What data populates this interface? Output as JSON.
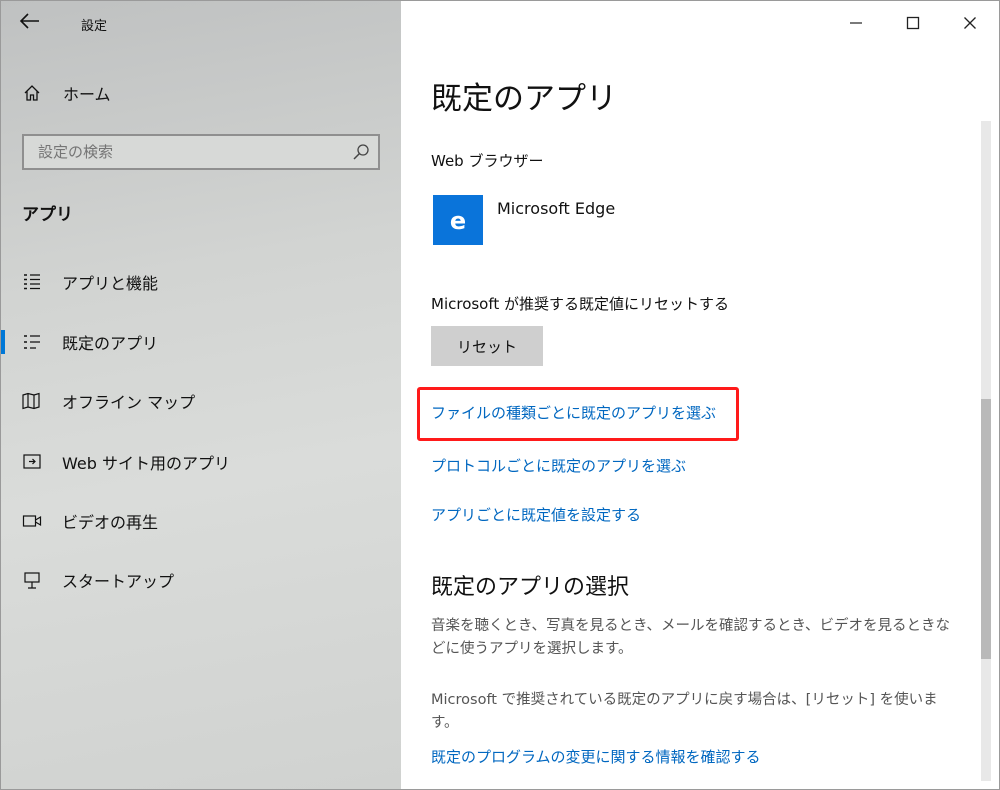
{
  "window": {
    "title": "設定",
    "minimize_icon": "minimize-icon",
    "maximize_icon": "maximize-icon",
    "close_icon": "close-icon"
  },
  "sidebar": {
    "home_label": "ホーム",
    "search_placeholder": "設定の検索",
    "section_heading": "アプリ",
    "items": [
      {
        "label": "アプリと機能",
        "icon": "apps-features-icon",
        "selected": false
      },
      {
        "label": "既定のアプリ",
        "icon": "default-apps-icon",
        "selected": true
      },
      {
        "label": "オフライン マップ",
        "icon": "offline-maps-icon",
        "selected": false
      },
      {
        "label": "Web サイト用のアプリ",
        "icon": "apps-for-websites-icon",
        "selected": false
      },
      {
        "label": "ビデオの再生",
        "icon": "video-playback-icon",
        "selected": false
      },
      {
        "label": "スタートアップ",
        "icon": "startup-icon",
        "selected": false
      }
    ]
  },
  "main": {
    "page_title": "既定のアプリ",
    "web_browser_label": "Web ブラウザー",
    "web_browser_app": "Microsoft Edge",
    "reset_heading": "Microsoft が推奨する既定値にリセットする",
    "reset_button": "リセット",
    "links": [
      "ファイルの種類ごとに既定のアプリを選ぶ",
      "プロトコルごとに既定のアプリを選ぶ",
      "アプリごとに既定値を設定する"
    ],
    "choose_heading": "既定のアプリの選択",
    "description_1": "音楽を聴くとき、写真を見るとき、メールを確認するとき、ビデオを見るときなどに使うアプリを選択します。",
    "description_2": "Microsoft で推奨されている既定のアプリに戻す場合は、[リセット] を使います。",
    "info_link": "既定のプログラムの変更に関する情報を確認する"
  },
  "colors": {
    "accent": "#0078d7",
    "link": "#0067c0",
    "edge_tile": "#0a74da",
    "highlight": "#ff1a1a"
  }
}
